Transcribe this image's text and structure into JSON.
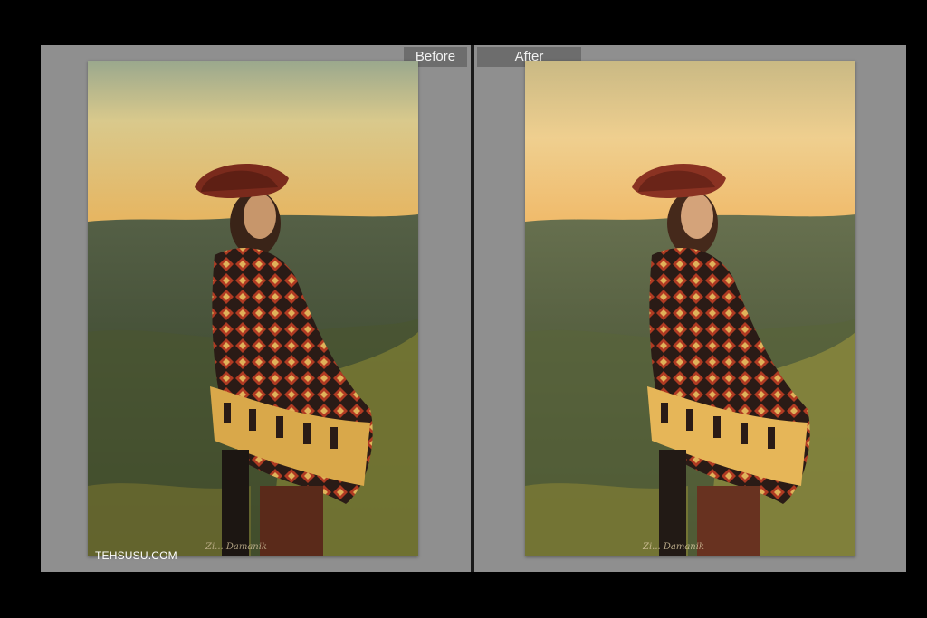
{
  "view": {
    "before_label": "Before",
    "after_label": "After"
  },
  "photo": {
    "subject": "woman in red hat and patterned poncho on hillside at sunset",
    "signature": "Zi... Damanik"
  },
  "watermark": "TEHSUSU.COM",
  "colors": {
    "background": "#000000",
    "panel": "#8f8f8f",
    "label_bg": "#6d6d6d",
    "label_text": "#f2f2f2"
  }
}
